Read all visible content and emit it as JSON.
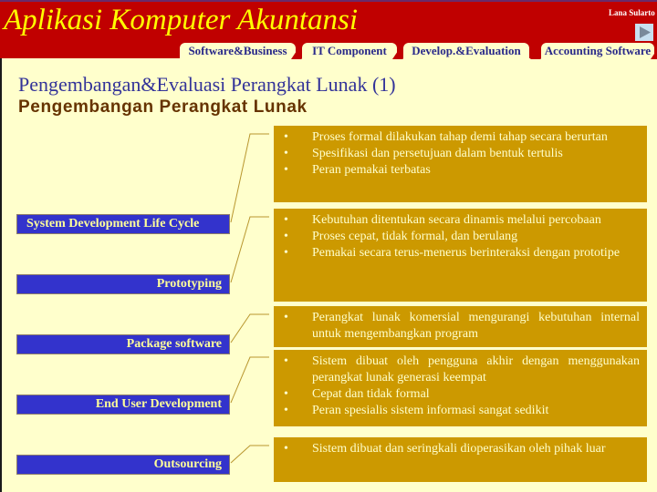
{
  "header": {
    "app_title": "Aplikasi Komputer Akuntansi",
    "author": "Lana Sularto",
    "next_icon": "play-triangle-icon",
    "tabs": [
      {
        "label": "Software&Business"
      },
      {
        "label": "IT Component"
      },
      {
        "label": "Develop.&Evaluation"
      },
      {
        "label": "Accounting Software"
      }
    ]
  },
  "slide": {
    "title": "Pengembangan&Evaluasi Perangkat Lunak (1)",
    "subtitle": "Pengembangan Perangkat Lunak",
    "bullet_glyph": "•",
    "methods": [
      {
        "label": "System Development Life Cycle",
        "points": [
          "Proses formal dilakukan tahap demi tahap secara berurtan",
          "Spesifikasi dan persetujuan dalam bentuk tertulis",
          "Peran pemakai terbatas"
        ]
      },
      {
        "label": "Prototyping",
        "points": [
          "Kebutuhan ditentukan secara dinamis melalui percobaan",
          "Proses cepat, tidak formal, dan berulang",
          "Pemakai secara terus-menerus berinteraksi dengan prototipe"
        ]
      },
      {
        "label": "Package software",
        "points": [
          "Perangkat lunak komersial mengurangi kebutuhan internal untuk mengembangkan program"
        ]
      },
      {
        "label": "End User Development",
        "points": [
          "Sistem dibuat oleh pengguna akhir dengan menggunakan perangkat lunak generasi keempat",
          "Cepat dan tidak formal",
          "Peran spesialis sistem informasi sangat sedikit"
        ]
      },
      {
        "label": "Outsourcing",
        "points": [
          "Sistem dibuat dan seringkali dioperasikan oleh pihak luar"
        ]
      }
    ]
  },
  "colors": {
    "header_bg": "#C00000",
    "title_yellow": "#FFFF00",
    "page_bg": "#FFFFCC",
    "label_bg": "#3333CC",
    "desc_bg": "#CC9900",
    "tab_text": "#2A2A8A"
  }
}
